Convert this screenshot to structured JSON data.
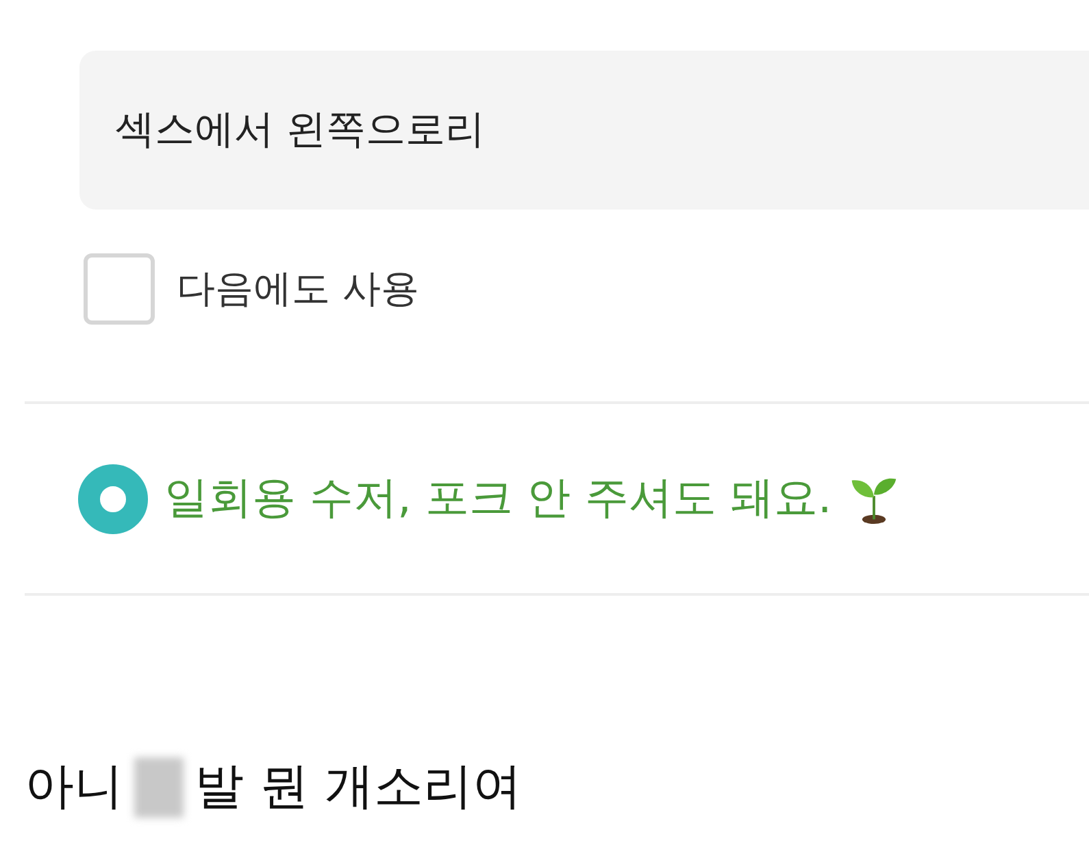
{
  "request_field": {
    "value": "섹스에서 왼쪽으로리"
  },
  "reuse_checkbox": {
    "label": "다음에도 사용",
    "checked": false
  },
  "cutlery_option": {
    "label": "일회용 수저, 포크 안 주셔도 돼요.",
    "selected": true
  },
  "caption": {
    "before": "아니",
    "after": "발 뭔 개소리여"
  }
}
